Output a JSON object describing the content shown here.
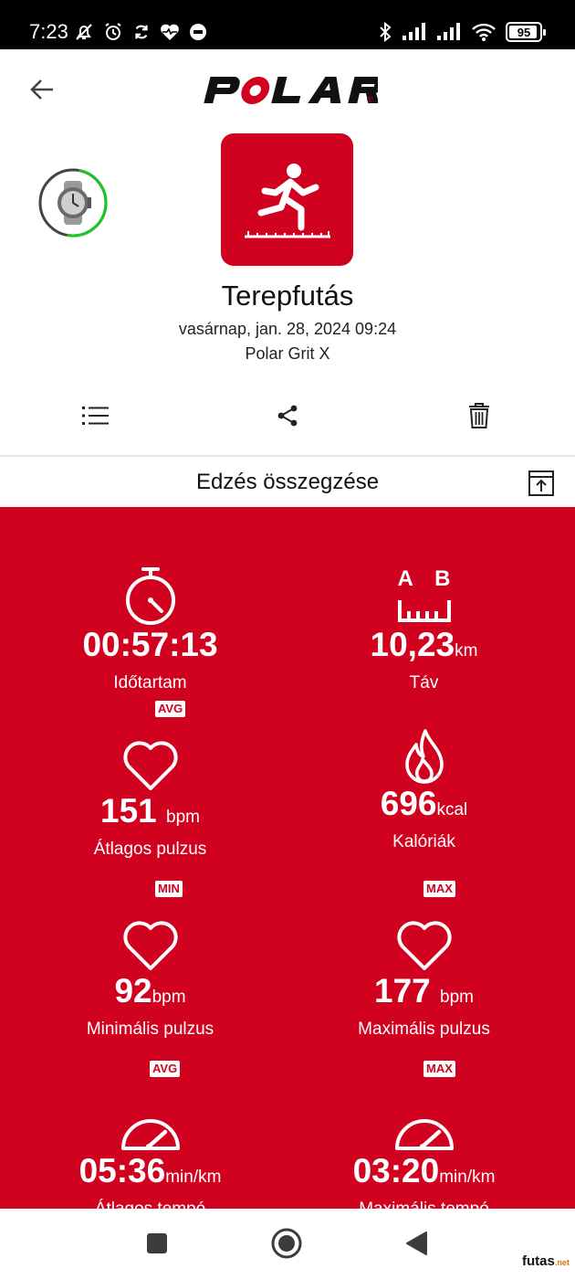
{
  "status_bar": {
    "time": "7:23",
    "battery": "95",
    "battery_fraction": 0.95,
    "left_icons": [
      "mute-bell-icon",
      "alarm-icon",
      "sync-icon",
      "heart-rate-icon",
      "record-icon"
    ],
    "right_icons": [
      "bluetooth-icon",
      "signal-icon",
      "signal-icon",
      "wifi-icon",
      "battery-icon"
    ]
  },
  "header": {
    "logo_text": "POLAR",
    "registered_mark": "®"
  },
  "activity": {
    "sport_name": "Terepfutás",
    "date": "vasárnap, jan. 28, 2024 09:24",
    "device": "Polar Grit X",
    "sport_icon": "trail-running-icon",
    "accent_color": "#d1021f",
    "sync_ring_color": "#22c32a"
  },
  "actions": {
    "list_icon": "list-icon",
    "share_icon": "share-icon",
    "delete_icon": "trash-icon"
  },
  "summary": {
    "title": "Edzés összegzése",
    "metrics": [
      {
        "value": "00:57:13",
        "unit": "",
        "label": "Időtartam",
        "tag": "",
        "icon": "stopwatch-icon"
      },
      {
        "value": "10,23",
        "unit": "km",
        "label": "Táv",
        "tag": "",
        "icon": "distance-icon",
        "icon_letters": [
          "A",
          "B"
        ]
      },
      {
        "value": "151",
        "unit": "bpm",
        "label": "Átlagos pulzus",
        "tag": "AVG",
        "icon": "heart-icon"
      },
      {
        "value": "696",
        "unit": "kcal",
        "label": "Kalóriák",
        "tag": "",
        "icon": "flame-icon"
      },
      {
        "value": "92",
        "unit": "bpm",
        "label": "Minimális pulzus",
        "tag": "MIN",
        "icon": "heart-icon"
      },
      {
        "value": "177",
        "unit": "bpm",
        "label": "Maximális pulzus",
        "tag": "MAX",
        "icon": "heart-icon"
      },
      {
        "value": "05:36",
        "unit": "min/km",
        "label": "Átlagos tempó",
        "tag": "AVG",
        "icon": "speedometer-icon"
      },
      {
        "value": "03:20",
        "unit": "min/km",
        "label": "Maximális tempó",
        "tag": "MAX",
        "icon": "speedometer-icon"
      }
    ]
  },
  "watermark": {
    "text": "futas",
    "suffix": ".net"
  }
}
